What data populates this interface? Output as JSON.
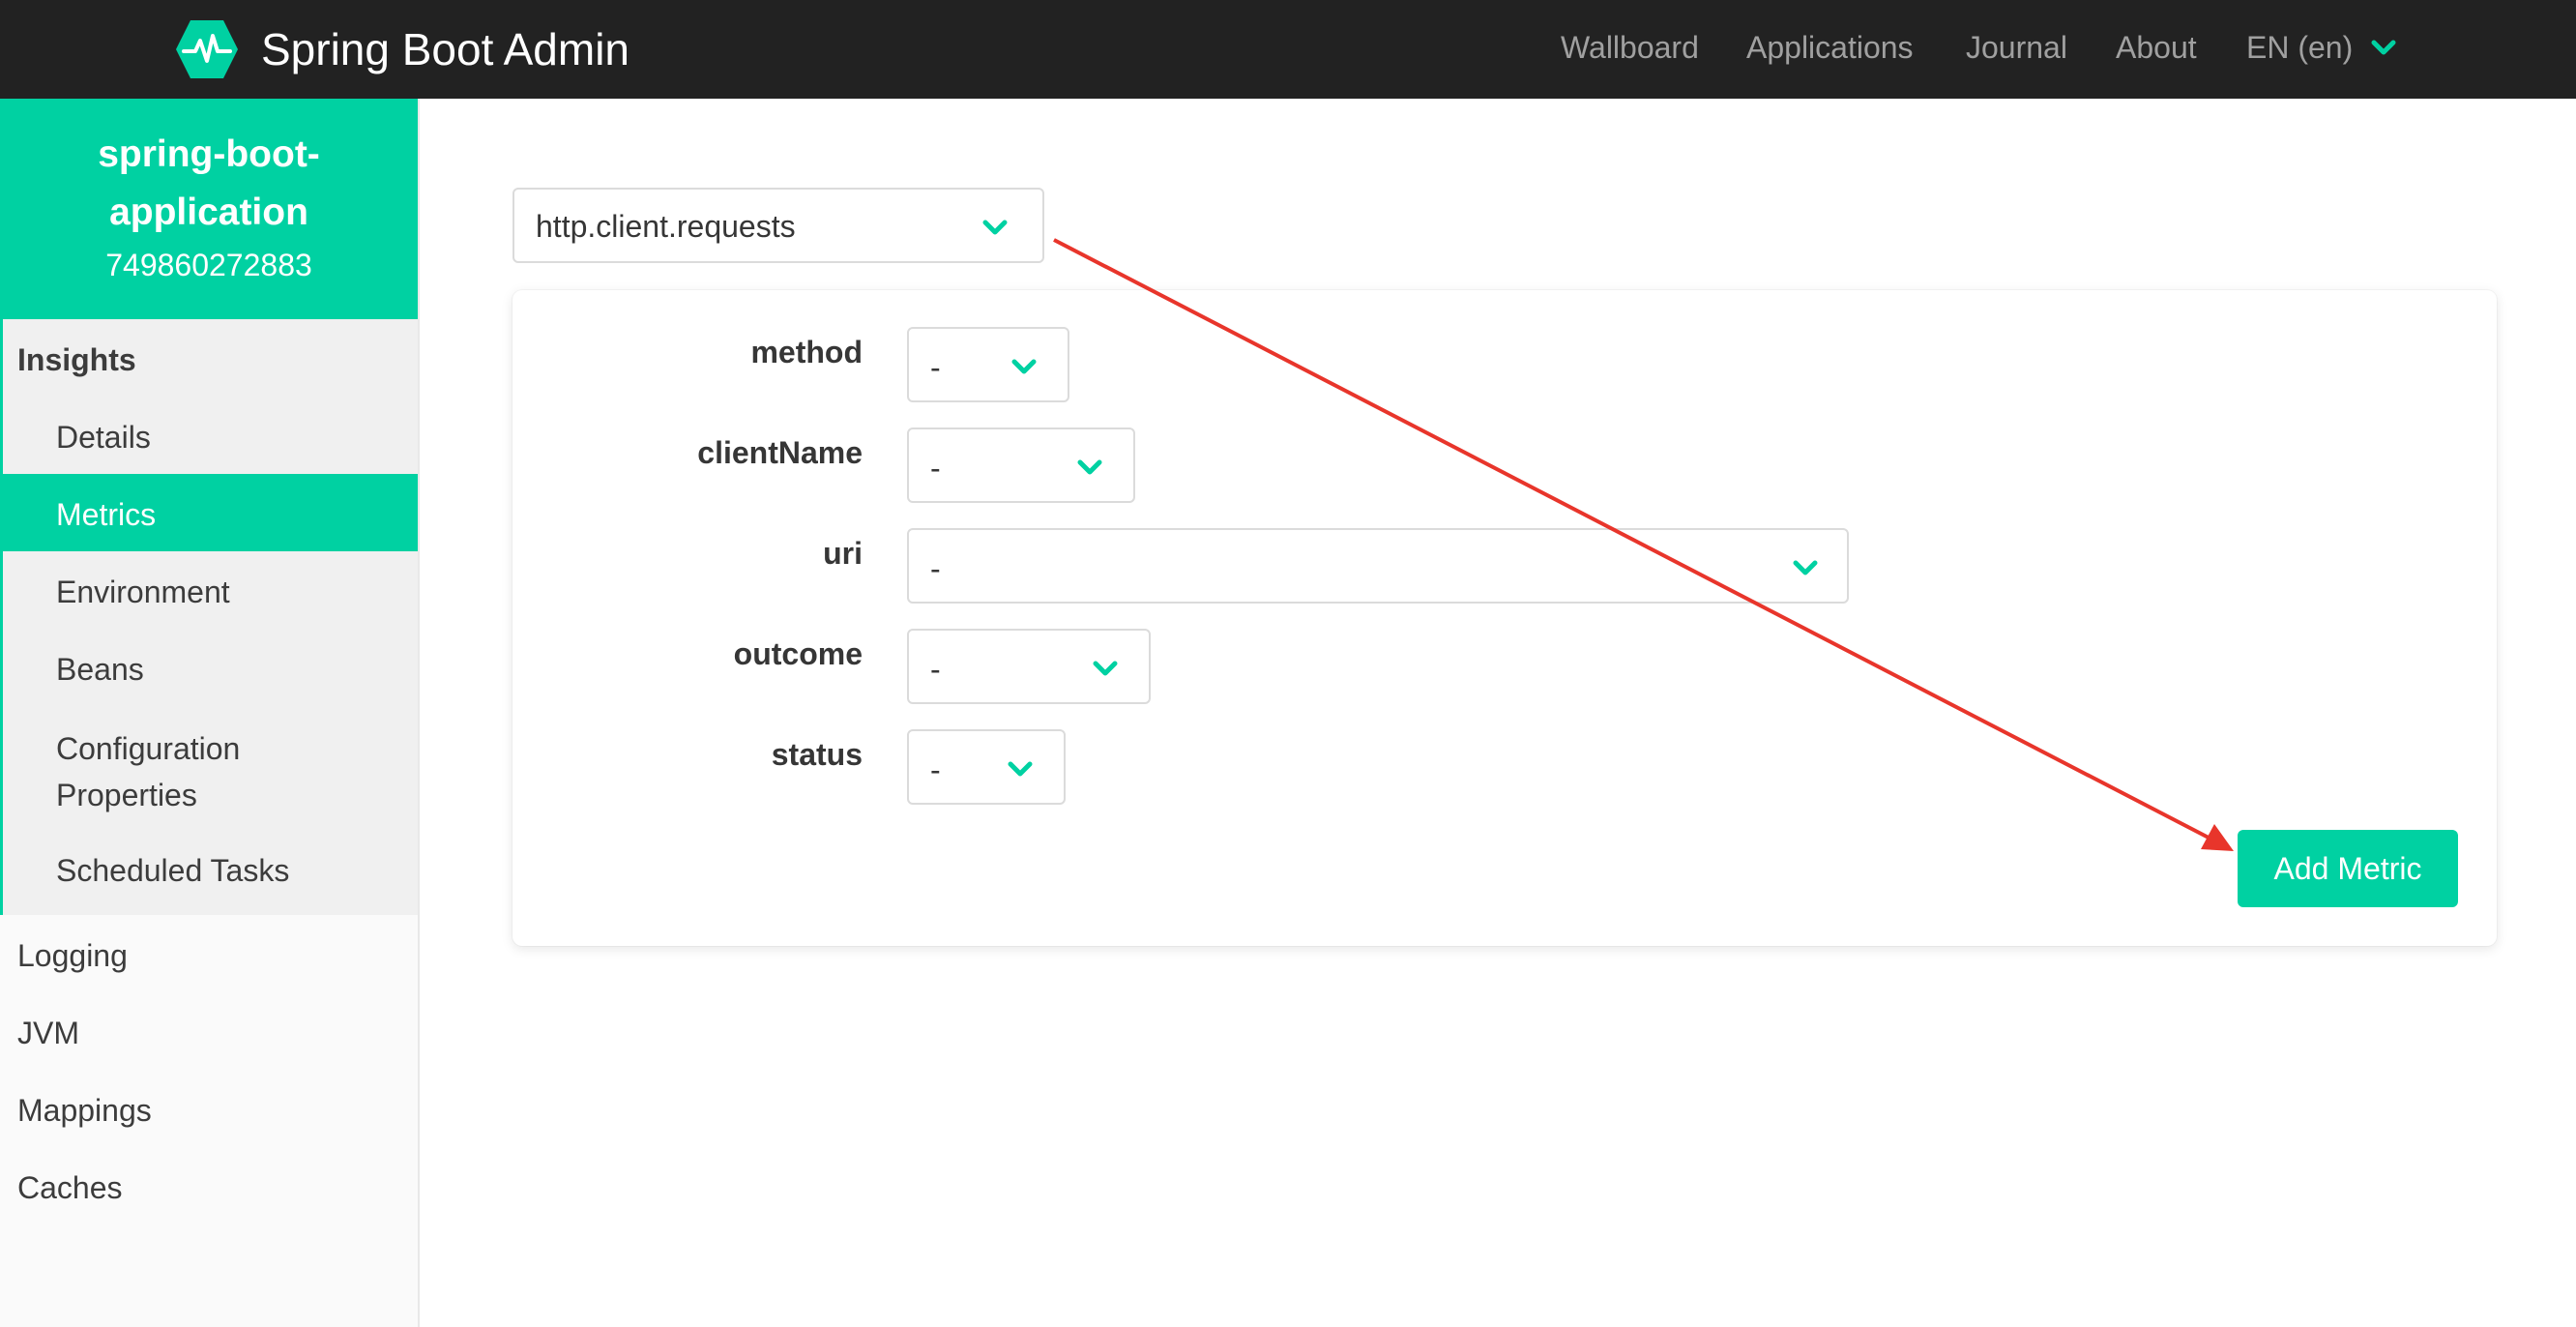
{
  "navbar": {
    "brand": "Spring Boot Admin",
    "items": [
      "Wallboard",
      "Applications",
      "Journal",
      "About"
    ],
    "language": "EN (en)"
  },
  "sidebar": {
    "app_name": "spring-boot-application",
    "app_id": "749860272883",
    "group_label": "Insights",
    "group_items": [
      "Details",
      "Metrics",
      "Environment",
      "Beans",
      "Configuration Properties",
      "Scheduled Tasks"
    ],
    "active_item": "Metrics",
    "items": [
      "Logging",
      "JVM",
      "Mappings",
      "Caches"
    ]
  },
  "main": {
    "metric_select": {
      "value": "http.client.requests"
    },
    "tags": [
      {
        "label": "method",
        "value": "-"
      },
      {
        "label": "clientName",
        "value": "-"
      },
      {
        "label": "uri",
        "value": "-"
      },
      {
        "label": "outcome",
        "value": "-"
      },
      {
        "label": "status",
        "value": "-"
      }
    ],
    "add_button": "Add Metric"
  },
  "colors": {
    "accent": "#00d1a2",
    "navbar_bg": "#222222",
    "sidebar_bg": "#fafafa",
    "annotation_arrow": "#e8352b"
  },
  "icons": {
    "brand": "heartbeat-hexagon-icon",
    "dropdown": "chevron-down-icon"
  }
}
